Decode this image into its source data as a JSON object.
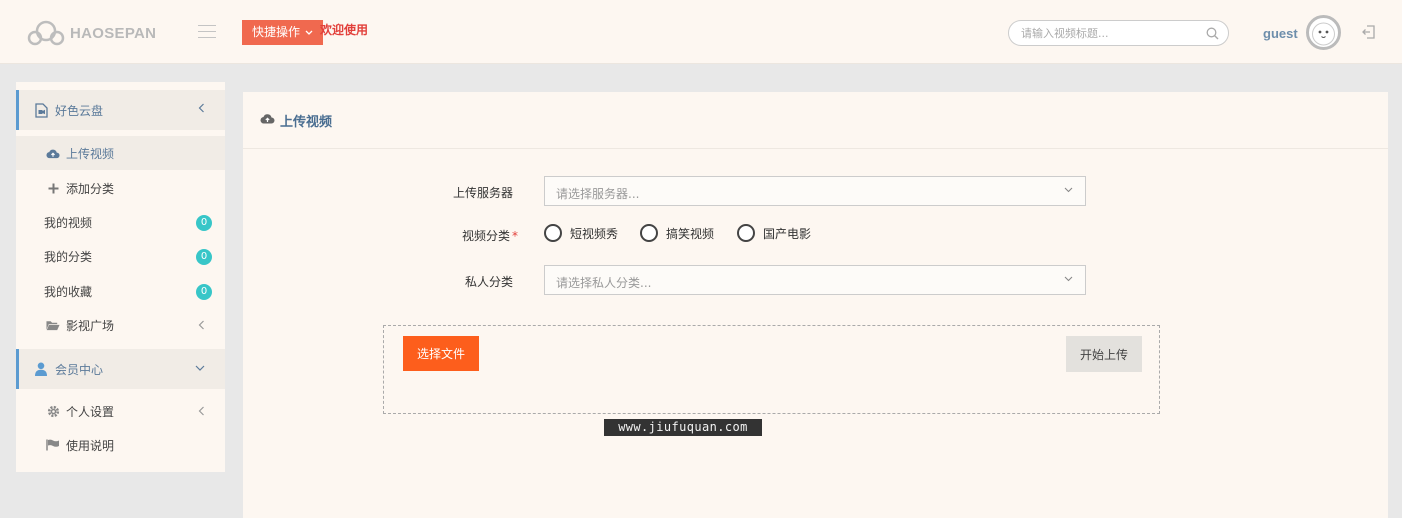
{
  "header": {
    "logo_text": "HAOSEPAN",
    "quick_label": "快捷操作",
    "welcome": "欢迎使用",
    "search_placeholder": "请输入视频标题...",
    "username": "guest"
  },
  "sidebar": {
    "group1": {
      "label": "好色云盘",
      "icon": "video-file-icon"
    },
    "items": [
      {
        "label": "上传视频",
        "icon": "cloud-upload-icon",
        "active": true
      },
      {
        "label": "添加分类",
        "icon": "plus-icon"
      },
      {
        "label": "我的视频",
        "badge": "0"
      },
      {
        "label": "我的分类",
        "badge": "0"
      },
      {
        "label": "我的收藏",
        "badge": "0"
      },
      {
        "label": "影视广场",
        "icon": "folder-open-icon"
      }
    ],
    "group2": {
      "label": "会员中心",
      "icon": "user-icon"
    },
    "items2": [
      {
        "label": "个人设置",
        "icon": "gear-icon"
      },
      {
        "label": "使用说明",
        "icon": "flag-icon"
      }
    ]
  },
  "main": {
    "title": "上传视频",
    "server_label": "上传服务器",
    "server_placeholder": "请选择服务器...",
    "category_label": "视频分类",
    "required_mark": "*",
    "categories": [
      "短视频秀",
      "搞笑视频",
      "国产电影"
    ],
    "private_label": "私人分类",
    "private_placeholder": "请选择私人分类...",
    "choose_file": "选择文件",
    "start_upload": "开始上传"
  },
  "watermark": "www.jiufuquan.com",
  "colors": {
    "accent_orange": "#fd5e1c",
    "quick_button": "#f0694f",
    "welcome_red": "#e2403b",
    "badge_teal": "#38c6c8",
    "sidebar_accent": "#5b9bd1"
  }
}
